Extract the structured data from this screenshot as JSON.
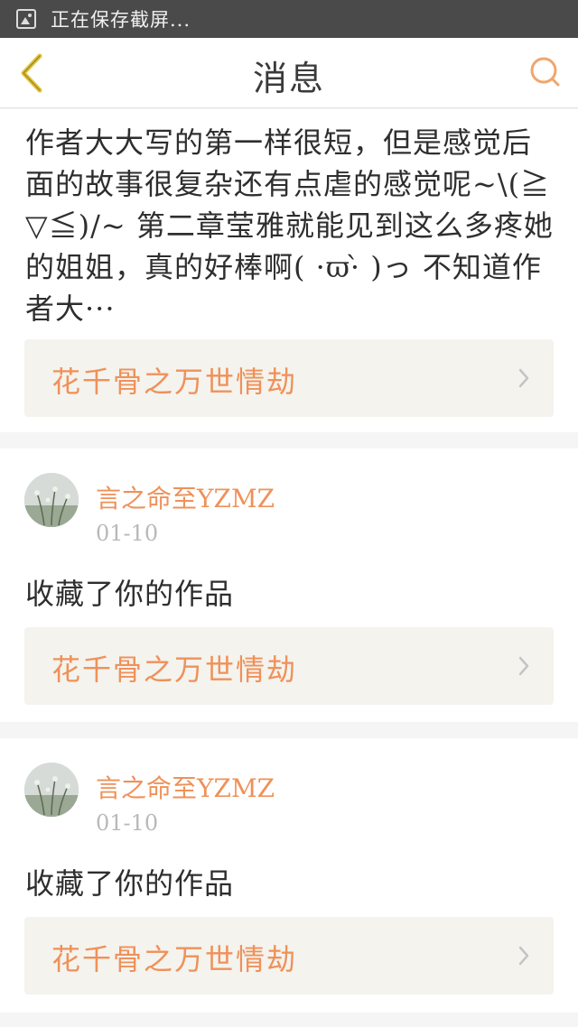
{
  "status_bar": {
    "text": "正在保存截屏...",
    "icon": "image-icon"
  },
  "header": {
    "title": "消息",
    "back_icon": "chevron-left-icon",
    "search_icon": "search-icon",
    "accent_color": "#f0a66e",
    "back_color": "#e2c43a"
  },
  "messages": [
    {
      "type": "comment",
      "text": "作者大大写的第一样很短，但是感觉后面的故事很复杂还有点虐的感觉呢~\\(≧▽≦)/~ 第二章莹雅就能见到这么多疼她的姐姐，真的好棒啊( ·ϖ·̀ )っ 不知道作者大···",
      "work_title": "花千骨之万世情劫"
    },
    {
      "type": "favorite",
      "user": "言之命至YZMZ",
      "date": "01-10",
      "text": "收藏了你的作品",
      "work_title": "花千骨之万世情劫"
    },
    {
      "type": "favorite",
      "user": "言之命至YZMZ",
      "date": "01-10",
      "text": "收藏了你的作品",
      "work_title": "花千骨之万世情劫"
    }
  ],
  "colors": {
    "link_text": "#ef9159",
    "link_bg": "#f4f3ee",
    "date_text": "#b9b9b9"
  }
}
